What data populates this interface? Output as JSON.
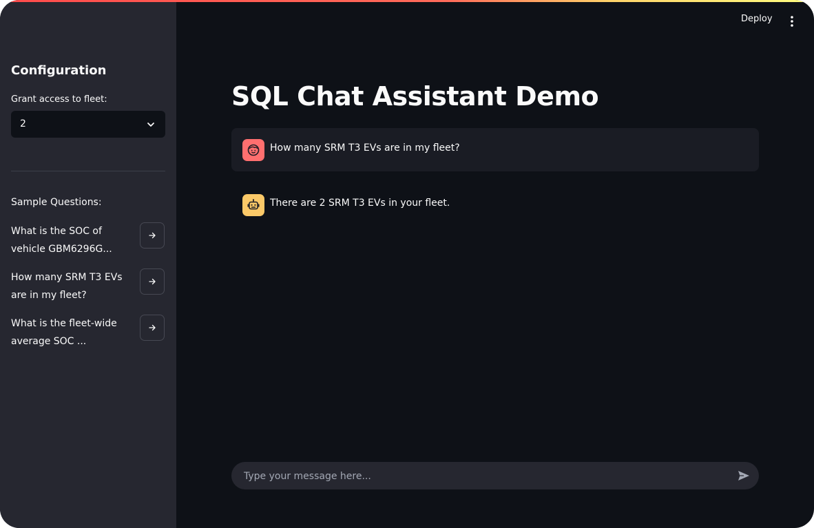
{
  "header": {
    "deploy_label": "Deploy",
    "menu_icon": "kebab-menu-icon"
  },
  "sidebar": {
    "title": "Configuration",
    "fleet_label": "Grant access to fleet:",
    "fleet_value": "2",
    "sample_title": "Sample Questions:",
    "questions": [
      {
        "text": "What is the SOC of vehicle GBM6296G..."
      },
      {
        "text": "How many SRM T3 EVs are in my fleet?"
      },
      {
        "text": "What is the fleet-wide average SOC ..."
      }
    ]
  },
  "main": {
    "title": "SQL Chat Assistant Demo",
    "messages": [
      {
        "role": "user",
        "text": "How many SRM T3 EVs are in my fleet?"
      },
      {
        "role": "assistant",
        "text": "There are 2 SRM T3 EVs in your fleet."
      }
    ]
  },
  "chat_input": {
    "placeholder": "Type your message here..."
  },
  "colors": {
    "background": "#0e1117",
    "sidebar": "#262730",
    "user_avatar": "#ff6f6f",
    "bot_avatar": "#fbc968"
  }
}
